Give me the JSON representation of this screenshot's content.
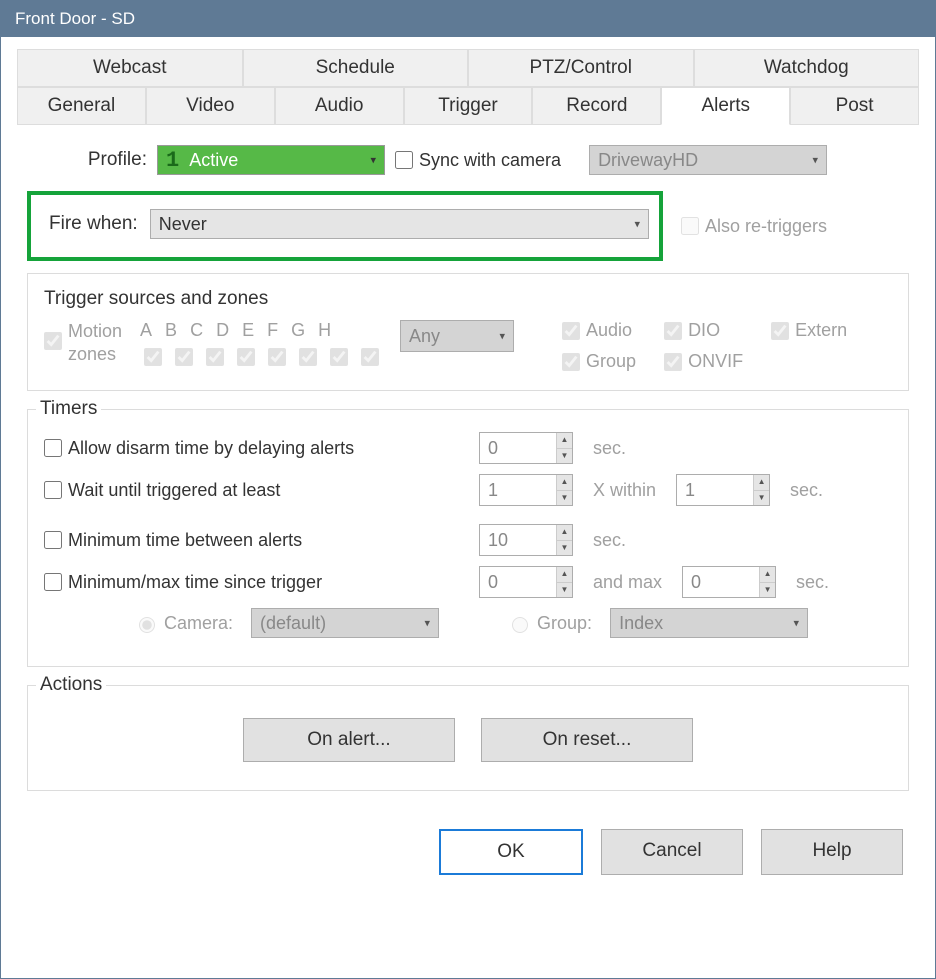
{
  "window": {
    "title": "Front Door - SD"
  },
  "tabs_upper": [
    "Webcast",
    "Schedule",
    "PTZ/Control",
    "Watchdog"
  ],
  "tabs_lower": [
    "General",
    "Video",
    "Audio",
    "Trigger",
    "Record",
    "Alerts",
    "Post"
  ],
  "active_tab": "Alerts",
  "profile": {
    "label": "Profile:",
    "index": "1",
    "value": "Active",
    "sync_label": "Sync with camera",
    "camera_value": "DrivewayHD"
  },
  "fire": {
    "label": "Fire when:",
    "value": "Never",
    "also_label": "Also re-triggers"
  },
  "triggers": {
    "legend": "Trigger sources and zones",
    "motion_label": "Motion zones",
    "letters": [
      "A",
      "B",
      "C",
      "D",
      "E",
      "F",
      "G",
      "H"
    ],
    "any": "Any",
    "checks": [
      "Audio",
      "DIO",
      "Extern",
      "Group",
      "ONVIF"
    ]
  },
  "timers": {
    "legend": "Timers",
    "allow": {
      "label": "Allow disarm time by delaying alerts",
      "val": "0",
      "unit": "sec."
    },
    "wait": {
      "label": "Wait until triggered at least",
      "val": "1",
      "mid": "X within",
      "val2": "1",
      "unit": "sec."
    },
    "min_between": {
      "label": "Minimum time between alerts",
      "val": "10",
      "unit": "sec."
    },
    "min_max": {
      "label": "Minimum/max time since trigger",
      "val": "0",
      "mid": "and max",
      "val2": "0",
      "unit": "sec."
    },
    "camera_radio": "Camera:",
    "camera_val": "(default)",
    "group_radio": "Group:",
    "group_val": "Index"
  },
  "actions": {
    "legend": "Actions",
    "on_alert": "On alert...",
    "on_reset": "On reset..."
  },
  "footer": {
    "ok": "OK",
    "cancel": "Cancel",
    "help": "Help"
  }
}
